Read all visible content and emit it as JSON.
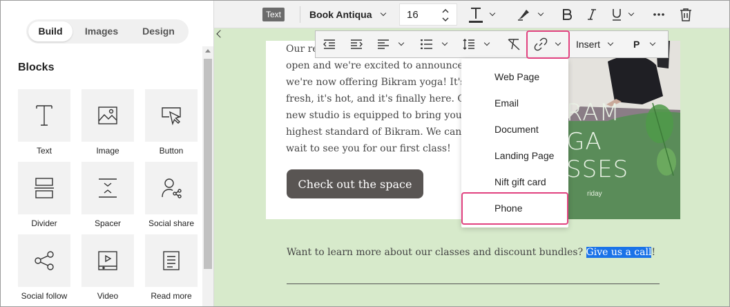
{
  "left_panel": {
    "tabs": [
      {
        "label": "Build",
        "active": true
      },
      {
        "label": "Images",
        "active": false
      },
      {
        "label": "Design",
        "active": false
      }
    ],
    "blocks_title": "Blocks",
    "blocks": [
      {
        "label": "Text",
        "icon": "text-icon"
      },
      {
        "label": "Image",
        "icon": "image-icon"
      },
      {
        "label": "Button",
        "icon": "button-icon"
      },
      {
        "label": "Divider",
        "icon": "divider-icon"
      },
      {
        "label": "Spacer",
        "icon": "spacer-icon"
      },
      {
        "label": "Social share",
        "icon": "social-share-icon"
      },
      {
        "label": "Social follow",
        "icon": "social-follow-icon"
      },
      {
        "label": "Video",
        "icon": "video-icon"
      },
      {
        "label": "Read more",
        "icon": "read-more-icon"
      }
    ]
  },
  "toolbar": {
    "badge": "Text",
    "font_family": "Book Antiqua",
    "font_size": "16",
    "icons": [
      "text-color-icon",
      "highlighter-icon",
      "bold-icon",
      "italic-icon",
      "underline-icon",
      "more-icon",
      "trash-icon"
    ]
  },
  "format_toolbar": {
    "insert_label": "Insert",
    "paragraph_label": "P",
    "icons": [
      "outdent-icon",
      "indent-icon",
      "align-left-icon",
      "list-icon",
      "line-height-icon",
      "clear-format-icon",
      "link-icon"
    ],
    "highlight_color": "#e1417f"
  },
  "email": {
    "paragraph": [
      "Our re",
      "open and we're excited to announce",
      "we're now offering Bikram yoga! It's",
      "fresh, it's hot, and it's finally here. O",
      "new studio is equipped to bring you",
      "highest standard of Bikram. We can",
      "wait to see you for our first class!"
    ],
    "cta_label": "Check out the space",
    "image_text": [
      "RAM",
      "GA",
      "SSES"
    ],
    "image_small": "riday",
    "lower_before": "Want to learn more about our classes and discount bundles? ",
    "lower_selected": "Give us a call",
    "lower_after": "!",
    "colors": {
      "background": "#d7eacb",
      "cta": "#595553",
      "selection": "#1a73e8"
    }
  },
  "link_menu": {
    "items": [
      "Web Page",
      "Email",
      "Document",
      "Landing Page",
      "Nift gift card",
      "Phone"
    ],
    "highlighted": "Phone"
  }
}
